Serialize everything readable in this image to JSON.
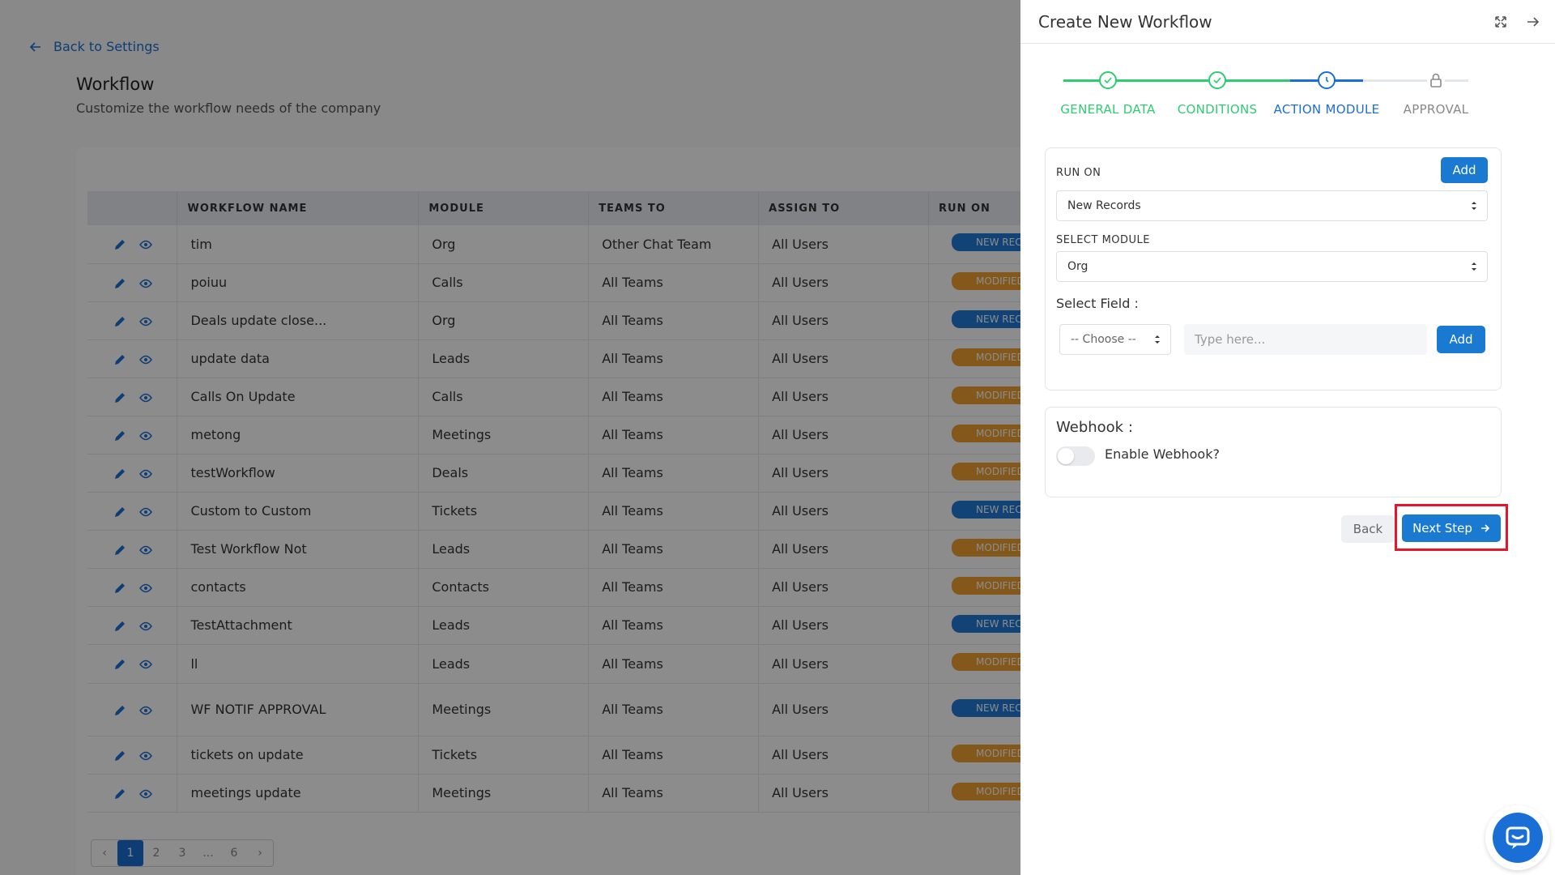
{
  "background": {
    "back_link": "Back to Settings",
    "title": "Workflow",
    "subtitle": "Customize the workflow needs of the company",
    "table": {
      "headers": [
        "",
        "WORKFLOW NAME",
        "MODULE",
        "TEAMS TO",
        "ASSIGN TO",
        "RUN ON"
      ],
      "rows": [
        {
          "name": "tim",
          "module": "Org",
          "teams": "Other Chat Team",
          "assign": "All Users",
          "run_on": "NEW REC",
          "run_type": "new"
        },
        {
          "name": "poiuu",
          "module": "Calls",
          "teams": "All Teams",
          "assign": "All Users",
          "run_on": "MODIFIED R",
          "run_type": "mod"
        },
        {
          "name": "Deals update close...",
          "module": "Org",
          "teams": "All Teams",
          "assign": "All Users",
          "run_on": "NEW REC",
          "run_type": "new"
        },
        {
          "name": "update data",
          "module": "Leads",
          "teams": "All Teams",
          "assign": "All Users",
          "run_on": "MODIFIED R",
          "run_type": "mod"
        },
        {
          "name": "Calls On Update",
          "module": "Calls",
          "teams": "All Teams",
          "assign": "All Users",
          "run_on": "MODIFIED R",
          "run_type": "mod"
        },
        {
          "name": "metong",
          "module": "Meetings",
          "teams": "All Teams",
          "assign": "All Users",
          "run_on": "MODIFIED R",
          "run_type": "mod"
        },
        {
          "name": "testWorkflow",
          "module": "Deals",
          "teams": "All Teams",
          "assign": "All Users",
          "run_on": "MODIFIED R",
          "run_type": "mod"
        },
        {
          "name": "Custom to Custom",
          "module": "Tickets",
          "teams": "All Teams",
          "assign": "All Users",
          "run_on": "NEW REC",
          "run_type": "new"
        },
        {
          "name": "Test Workflow Not",
          "module": "Leads",
          "teams": "All Teams",
          "assign": "All Users",
          "run_on": "MODIFIED R",
          "run_type": "mod"
        },
        {
          "name": "contacts",
          "module": "Contacts",
          "teams": "All Teams",
          "assign": "All Users",
          "run_on": "MODIFIED R",
          "run_type": "mod"
        },
        {
          "name": "TestAttachment",
          "module": "Leads",
          "teams": "All Teams",
          "assign": "All Users",
          "run_on": "NEW REC",
          "run_type": "new"
        },
        {
          "name": "ll",
          "module": "Leads",
          "teams": "All Teams",
          "assign": "All Users",
          "run_on": "MODIFIED R",
          "run_type": "mod"
        },
        {
          "name": "WF NOTIF APPROVAL",
          "module": "Meetings",
          "teams": "All Teams",
          "assign": "All Users",
          "run_on": "NEW REC",
          "run_type": "new"
        },
        {
          "name": "tickets on update",
          "module": "Tickets",
          "teams": "All Teams",
          "assign": "All Users",
          "run_on": "MODIFIED R",
          "run_type": "mod"
        },
        {
          "name": "meetings update",
          "module": "Meetings",
          "teams": "All Teams",
          "assign": "All Users",
          "run_on": "MODIFIED R",
          "run_type": "mod"
        }
      ]
    },
    "pagination": {
      "items": [
        "‹",
        "1",
        "2",
        "3",
        "...",
        "6",
        "›"
      ],
      "active": "1"
    }
  },
  "panel": {
    "title": "Create New Workflow",
    "steps": [
      {
        "label": "GENERAL DATA",
        "state": "done"
      },
      {
        "label": "CONDITIONS",
        "state": "done"
      },
      {
        "label": "ACTION MODULE",
        "state": "current"
      },
      {
        "label": "APPROVAL",
        "state": "locked"
      }
    ],
    "run_on": {
      "label": "RUN ON",
      "add_label": "Add",
      "value": "New Records"
    },
    "select_module": {
      "label": "SELECT MODULE",
      "value": "Org"
    },
    "select_field": {
      "label": "Select Field :",
      "choose": "-- Choose --",
      "placeholder": "Type here...",
      "add_label": "Add"
    },
    "webhook": {
      "title": "Webhook :",
      "toggle_label": "Enable Webhook?",
      "enabled": false
    },
    "back_label": "Back",
    "next_label": "Next Step"
  },
  "colors": {
    "accent": "#1a7ad2",
    "done": "#2ecc71",
    "badge_new": "#1f7ad8",
    "badge_modified": "#f0a030",
    "highlight": "#e3162e"
  }
}
